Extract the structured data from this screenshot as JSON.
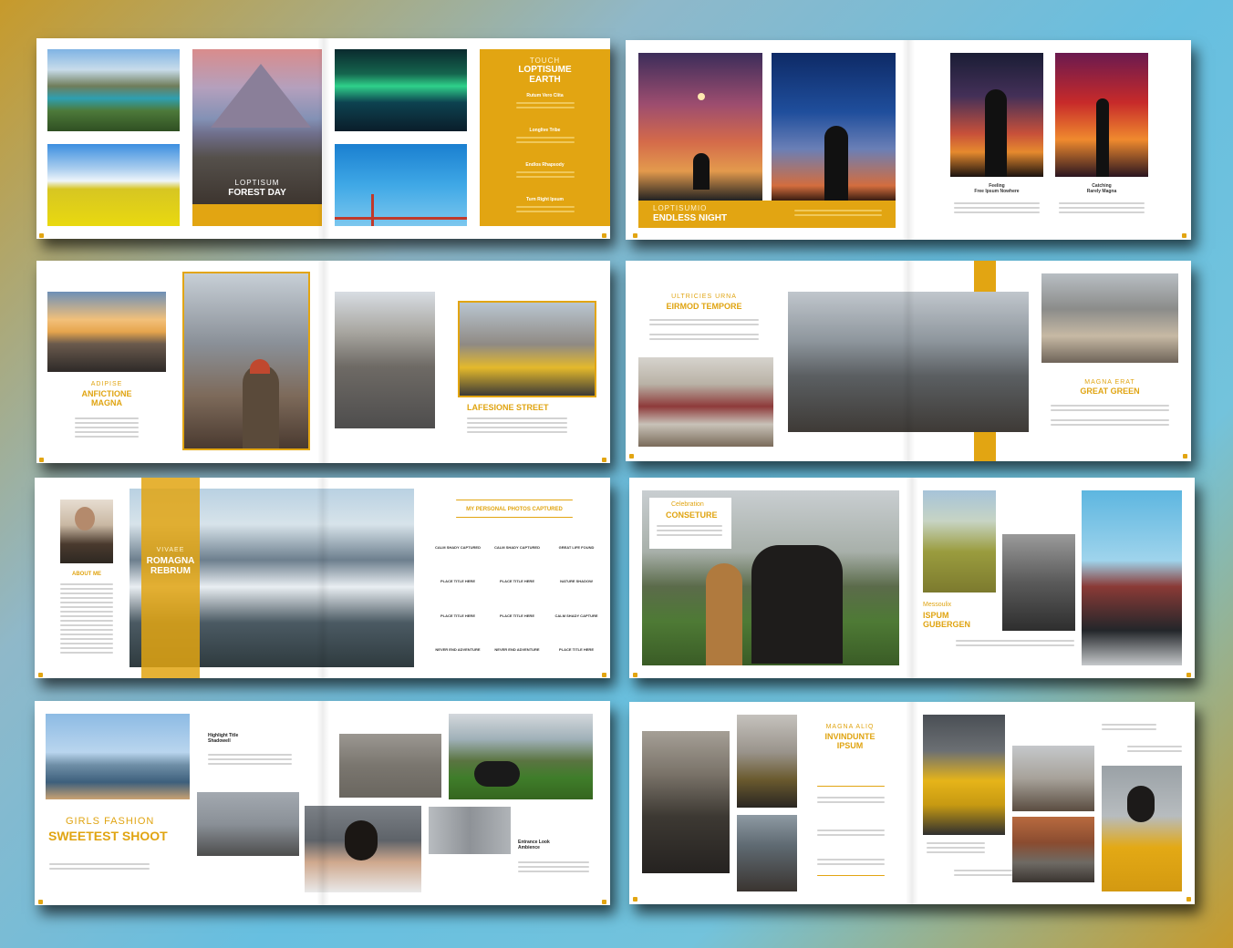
{
  "spread1": {
    "forest": {
      "kicker": "LOPTISUM",
      "title": "FOREST DAY"
    },
    "panel": {
      "kicker": "TOUCH",
      "title_line1": "LOPTISUME",
      "title_line2": "EARTH",
      "items": [
        "Rutum Vero Clita",
        "Longlive Tribe",
        "Endlos Rhapsody",
        "Turn Right Ipsum"
      ]
    }
  },
  "spread2": {
    "night": {
      "kicker": "LOPTISUMIO",
      "title": "ENDLESS NIGHT"
    },
    "cap1": {
      "line1": "Feeling",
      "line2": "Free Ipsum Nowhere"
    },
    "cap2": {
      "line1": "Catching",
      "line2": "Rarely Magna"
    }
  },
  "spread3": {
    "left": {
      "kicker": "ADIPISE",
      "title_line1": "ANFICTIONE",
      "title_line2": "MAGNA"
    },
    "right": {
      "title": "LAFESIONE STREET"
    }
  },
  "spread4": {
    "left": {
      "kicker": "ULTRICIES URNA",
      "title": "EIRMOD TEMPORE"
    },
    "right": {
      "kicker": "MAGNA ERAT",
      "title": "GREAT GREEN"
    }
  },
  "spread5": {
    "about": "ABOUT ME",
    "overlay": {
      "kicker": "VIVAEE",
      "title_line1": "ROMAGNA",
      "title_line2": "REBRUM"
    },
    "personal_title": "MY PERSONAL PHOTOS CAPTURED",
    "grid": [
      "CALM SHADY CAPTURED",
      "CALM SHADY CAPTURED",
      "GREAT LIFE FOUND",
      "PLACE TITLE HERE",
      "PLACE TITLE HERE",
      "NATURE SHADOW",
      "PLACE TITLE HERE",
      "PLACE TITLE HERE",
      "CALM SHADY CAPTURE",
      "NEVER END ADVENTURE",
      "NEVER END ADVENTURE",
      "PLACE TITLE HERE"
    ]
  },
  "spread6": {
    "cel": {
      "kicker": "Celebration",
      "title": "CONSETURE"
    },
    "right": {
      "kicker": "Messoulix",
      "title_line1": "ISPUM",
      "title_line2": "GUBERGEN"
    }
  },
  "spread7": {
    "hl": {
      "line1": "Highlight Title",
      "line2": "Shadowell"
    },
    "girls": {
      "kicker": "GIRLS FASHION",
      "title": "SWEETEST SHOOT"
    },
    "entrance": {
      "line1": "Entrance Look",
      "line2": "Ambience"
    }
  },
  "spread8": {
    "inv": {
      "kicker": "MAGNA ALIQ",
      "title_line1": "INVINDUNTE",
      "title_line2": "IPSUM"
    }
  }
}
